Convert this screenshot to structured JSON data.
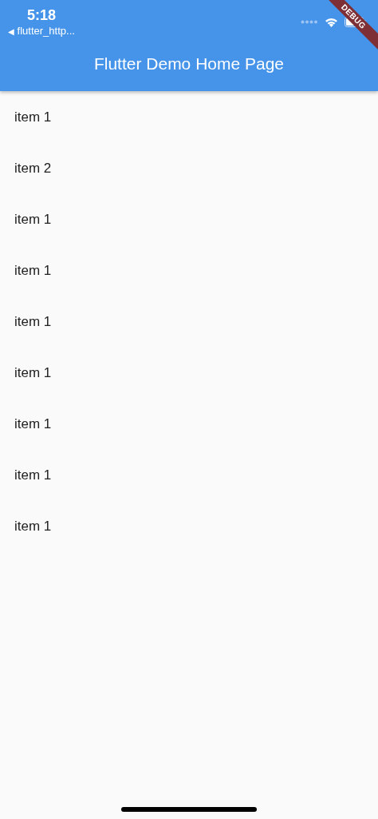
{
  "status_bar": {
    "time": "5:18",
    "back_arrow": "◀",
    "back_label": "flutter_http..."
  },
  "app_bar": {
    "title": "Flutter Demo Home Page"
  },
  "debug_banner": "DEBUG",
  "items": [
    {
      "label": "item 1"
    },
    {
      "label": "item 2"
    },
    {
      "label": "item 1"
    },
    {
      "label": "item 1"
    },
    {
      "label": "item 1"
    },
    {
      "label": "item 1"
    },
    {
      "label": "item 1"
    },
    {
      "label": "item 1"
    },
    {
      "label": "item 1"
    }
  ]
}
